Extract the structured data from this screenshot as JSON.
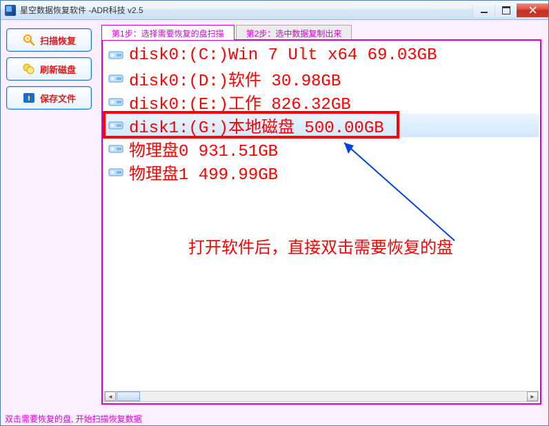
{
  "window": {
    "title": "星空数据恢复软件   -ADR科技 v2.5"
  },
  "sidebar": {
    "buttons": [
      {
        "label": "扫描恢复",
        "name": "scan-recover-button"
      },
      {
        "label": "刷新磁盘",
        "name": "refresh-disk-button"
      },
      {
        "label": "保存文件",
        "name": "save-file-button"
      }
    ]
  },
  "tabs": {
    "step1": "第1步：选择需要恢复的盘扫描",
    "step2": "第2步：选中数据复制出来"
  },
  "disks": [
    {
      "text": "disk0:(C:)Win 7 Ult x64 69.03GB",
      "selected": false
    },
    {
      "text": "disk0:(D:)软件 30.98GB",
      "selected": false
    },
    {
      "text": "disk0:(E:)工作 826.32GB",
      "selected": false
    },
    {
      "text": "disk1:(G:)本地磁盘 500.00GB",
      "selected": true
    },
    {
      "text": "物理盘0 931.51GB",
      "selected": false
    },
    {
      "text": "物理盘1 499.99GB",
      "selected": false
    }
  ],
  "annotation": {
    "text": "打开软件后，直接双击需要恢复的盘"
  },
  "statusbar": {
    "text": "双击需要恢复的盘, 开始扫描恢复数据"
  },
  "colors": {
    "accent": "#d400d4",
    "danger": "#ff0000",
    "button_text": "#e01919"
  }
}
